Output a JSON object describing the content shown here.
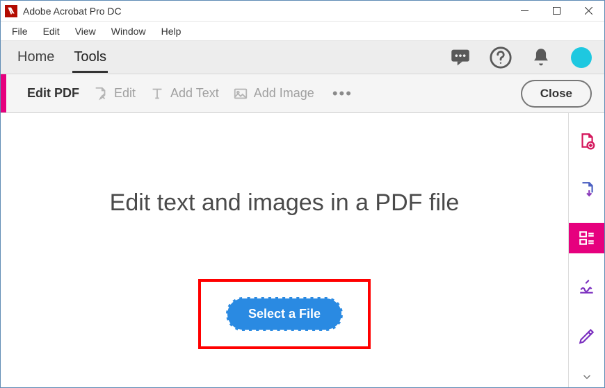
{
  "window": {
    "title": "Adobe Acrobat Pro DC"
  },
  "menubar": {
    "items": [
      "File",
      "Edit",
      "View",
      "Window",
      "Help"
    ]
  },
  "topnav": {
    "tabs": {
      "home": "Home",
      "tools": "Tools"
    },
    "active": "tools"
  },
  "toolbar": {
    "title": "Edit PDF",
    "edit_label": "Edit",
    "add_text_label": "Add Text",
    "add_image_label": "Add Image",
    "close_label": "Close"
  },
  "content": {
    "headline": "Edit text and images in a PDF file",
    "select_file_label": "Select a File"
  },
  "right_rail": {
    "items": [
      "create-pdf",
      "export-pdf",
      "organize-pages",
      "sign",
      "edit"
    ]
  },
  "colors": {
    "accent_magenta": "#e6007e",
    "accent_blue": "#2a8ae2",
    "highlight_red": "#ff0000"
  }
}
